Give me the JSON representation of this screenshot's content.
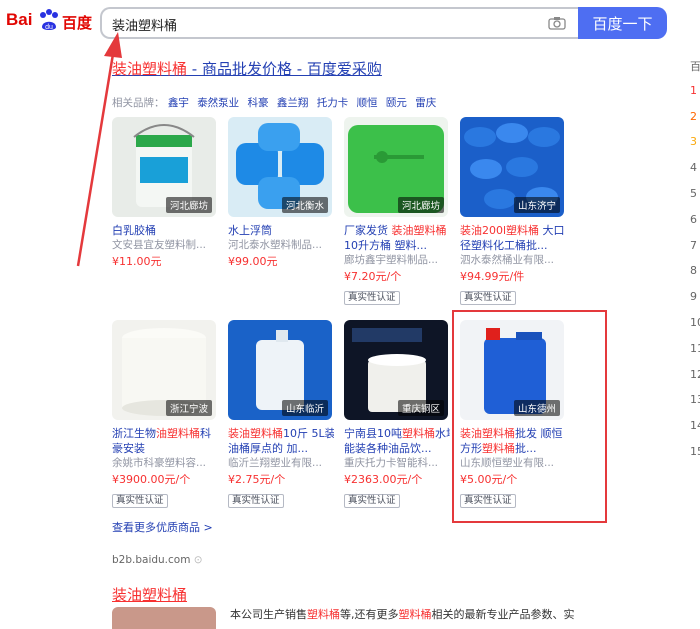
{
  "header": {
    "logo_text": "百度",
    "search_query": "装油塑料桶",
    "search_button": "百度一下"
  },
  "result": {
    "title_hl": "装油塑料桶",
    "title_rest": " - 商品批发价格 - 百度爱采购",
    "brand_label": "相关品牌：",
    "brands": [
      "鑫宇",
      "泰然泵业",
      "科豪",
      "鑫兰翔",
      "托力卡",
      "顺恒",
      "颐元",
      "雷庆"
    ]
  },
  "products": [
    {
      "title": "白乳胶桶",
      "seller": "文安县宜友塑料制...",
      "price": "¥11.00元",
      "location": "河北廊坊",
      "badge": ""
    },
    {
      "title": "水上浮筒",
      "seller": "河北泰水塑料制品...",
      "price": "¥99.00元",
      "location": "河北衡水",
      "badge": ""
    },
    {
      "title_a": "厂家发货 ",
      "title_b": "装油塑料桶",
      "title2": "10升方桶 塑料...",
      "seller": "廊坊鑫宇塑料制品...",
      "price": "¥7.20元/个",
      "location": "河北廊坊",
      "badge": "真实性认证"
    },
    {
      "title_a": "装油200l塑料桶",
      "title_b": " 大口",
      "title2": "径塑料化工桶批...",
      "seller": "泗水泰然桶业有限...",
      "price": "¥94.99元/件",
      "location": "山东济宁",
      "badge": "真实性认证"
    },
    {
      "title_a": "浙江生物",
      "title_b": "油塑料桶",
      "title_c": "科",
      "title2": "豪安装",
      "seller": "余姚市科豪塑料容...",
      "price": "¥3900.00元/个",
      "location": "浙江宁波",
      "badge": "真实性认证"
    },
    {
      "title_a": "装油塑料桶",
      "title_b": "10斤 5L装",
      "title2": "油桶厚点的 加...",
      "seller": "临沂兰翔塑业有限...",
      "price": "¥2.75元/个",
      "location": "山东临沂",
      "badge": "真实性认证"
    },
    {
      "title_a": "宁南县10吨",
      "title_b": "塑料桶",
      "title_c": "水塔",
      "title2": "能装各种油品饮...",
      "seller": "重庆托力卡智能科...",
      "price": "¥2363.00元/个",
      "location": "重庆铜区",
      "badge": "真实性认证"
    },
    {
      "title_a": "装油塑料桶",
      "title_b": "批发 顺恒",
      "title2_a": "方形",
      "title2_b": "塑料桶",
      "title2_c": "批...",
      "seller": "山东顺恒塑业有限...",
      "price": "¥5.00元/个",
      "location": "山东德州",
      "badge": "真实性认证"
    }
  ],
  "more_link": "查看更多优质商品 >",
  "source": "b2b.baidu.com",
  "result2": {
    "title": "装油塑料桶",
    "snippet_a": "本公司生产销售",
    "snippet_hl1": "塑料桶",
    "snippet_b": "等,还有更多",
    "snippet_hl2": "塑料桶",
    "snippet_c": "相关的最新专业产品参数、实"
  },
  "right_col": [
    "百",
    "1",
    "2",
    "3",
    "4",
    "5",
    "6",
    "7",
    "8",
    "9",
    "10",
    "11",
    "12",
    "13",
    "14",
    "15"
  ],
  "colors": {
    "accent": "#4e6ef2",
    "highlight": "#f73131",
    "link": "#2440b3",
    "annotation": "#e4393c"
  }
}
